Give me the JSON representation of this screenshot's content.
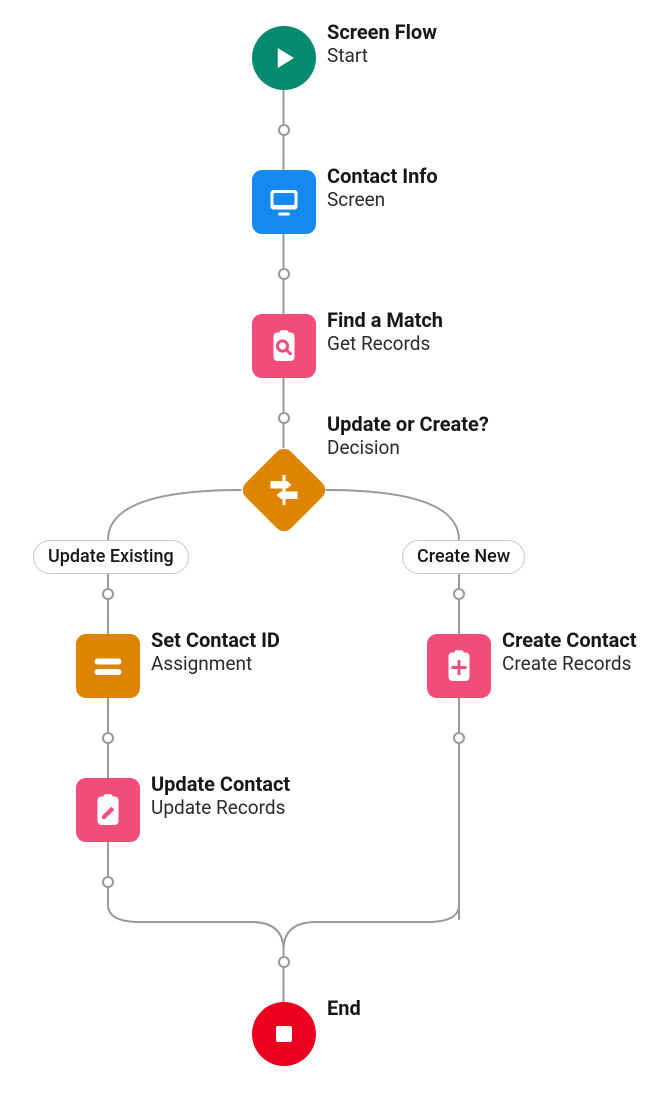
{
  "colors": {
    "start": "#048a6f",
    "screen": "#1589ee",
    "get": "#f04d7b",
    "decision": "#dd8500",
    "assignment": "#dd8500",
    "update": "#f04d7b",
    "create": "#f04d7b",
    "end": "#ea001e",
    "connector": "#9a9a9a"
  },
  "branches": {
    "left": "Update Existing",
    "right": "Create New"
  },
  "nodes": {
    "start": {
      "title": "Screen Flow",
      "sub": "Start"
    },
    "contactInfo": {
      "title": "Contact Info",
      "sub": "Screen"
    },
    "findMatch": {
      "title": "Find a Match",
      "sub": "Get Records"
    },
    "decision": {
      "title": "Update or Create?",
      "sub": "Decision"
    },
    "setContactId": {
      "title": "Set Contact ID",
      "sub": "Assignment"
    },
    "updateContact": {
      "title": "Update Contact",
      "sub": "Update Records"
    },
    "createContact": {
      "title": "Create Contact",
      "sub": "Create Records"
    },
    "end": {
      "title": "End",
      "sub": ""
    }
  }
}
